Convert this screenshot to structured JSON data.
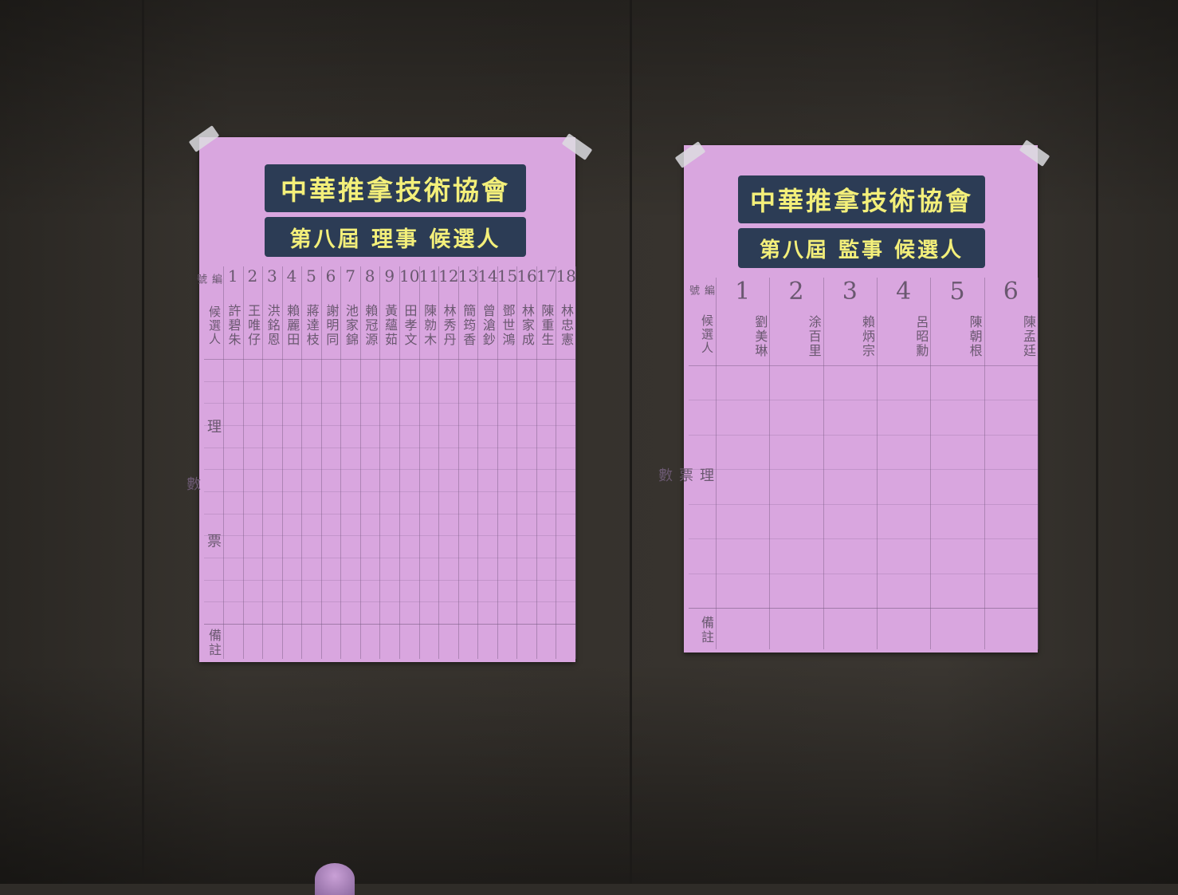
{
  "posters": [
    {
      "title": "中華推拿技術協會",
      "subtitle": "第八屆 理事 候選人",
      "header_label": "編號",
      "candidate_label": "候選人",
      "numbers": [
        "1",
        "2",
        "3",
        "4",
        "5",
        "6",
        "7",
        "8",
        "9",
        "10",
        "11",
        "12",
        "13",
        "14",
        "15",
        "16",
        "17",
        "18"
      ],
      "names": [
        "許碧朱",
        "王唯仔",
        "洪銘恩",
        "賴麗田",
        "蔣達枝",
        "謝明同",
        "池家錦",
        "賴冠源",
        "黃蘊茹",
        "田孝文",
        "陳勍木",
        "林秀丹",
        "簡筠香",
        "曾滄鈔",
        "鄧世鴻",
        "林家成",
        "陳重生",
        "林忠憲"
      ],
      "vote_label": "理 票 數",
      "remark_label": "備註"
    },
    {
      "title": "中華推拿技術協會",
      "subtitle": "第八屆 監事 候選人",
      "header_label": "編號",
      "candidate_label": "候選人",
      "numbers": [
        "1",
        "2",
        "3",
        "4",
        "5",
        "6"
      ],
      "names": [
        "劉美琳",
        "涂百里",
        "賴炳宗",
        "呂昭勳",
        "陳朝根",
        "陳孟廷"
      ],
      "vote_label": "理 票 數",
      "remark_label": "備註"
    }
  ]
}
